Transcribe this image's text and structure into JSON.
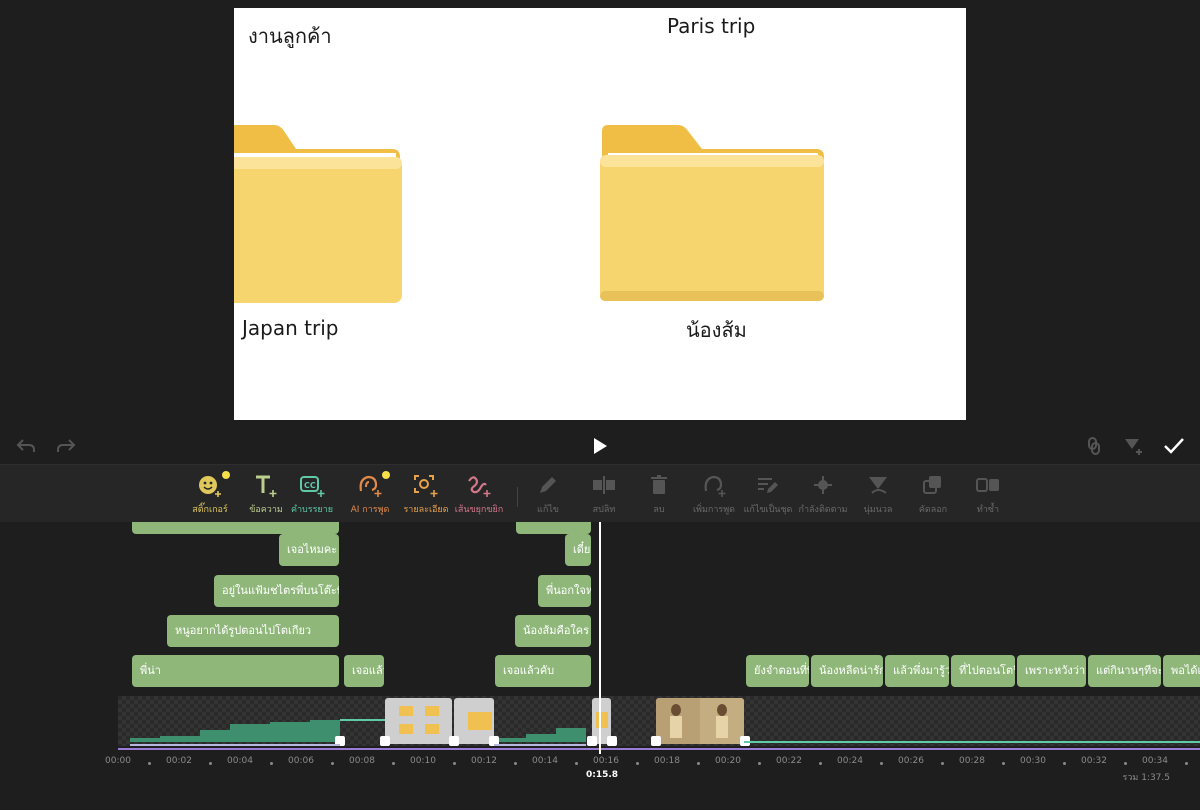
{
  "preview": {
    "folder_label_top_left": "งานลูกค้า",
    "folder_label_top_right": "Paris trip",
    "folder_label_bottom_left": "Japan trip",
    "folder_label_bottom_right": "น้องส้ม"
  },
  "toolbar": {
    "tools": [
      {
        "label": "สติ๊กเกอร์",
        "color": "#e0c85a"
      },
      {
        "label": "ข้อความ",
        "color": "#bcd08e"
      },
      {
        "label": "คำบรรยาย",
        "color": "#5fc9a8"
      },
      {
        "label": "AI การพูด",
        "color": "#e28a4a"
      },
      {
        "label": "รายละเอียด",
        "color": "#e8a14a"
      },
      {
        "label": "เส้นขยุกขยิก",
        "color": "#d3778a"
      },
      {
        "label": "แก้ไข",
        "color": "#6a6a6a"
      },
      {
        "label": "สปลิท",
        "color": "#6a6a6a"
      },
      {
        "label": "ลบ",
        "color": "#6a6a6a"
      },
      {
        "label": "เพิ่มการพูด",
        "color": "#6a6a6a"
      },
      {
        "label": "แก้ไขเป็นชุด",
        "color": "#6a6a6a"
      },
      {
        "label": "กำลังติดตาม",
        "color": "#6a6a6a"
      },
      {
        "label": "นุ่มนวล",
        "color": "#6a6a6a"
      },
      {
        "label": "คัดลอก",
        "color": "#6a6a6a"
      },
      {
        "label": "ทำซ้ำ",
        "color": "#6a6a6a"
      }
    ]
  },
  "captions": [
    {
      "text": "เจอไหมคะ"
    },
    {
      "text": "อยู่ในแฟ้มชไตรพี่บนโต๊ะพี่ ทา"
    },
    {
      "text": "หนูอยากได้รูปตอนไปโตเกียว"
    },
    {
      "text": "พี่น่า"
    },
    {
      "text": "เจอแล้ว"
    },
    {
      "text": "เดี๋ย"
    },
    {
      "text": "พี่นอกใจหร"
    },
    {
      "text": "น้องส้มคือใคร"
    },
    {
      "text": "เจอแล้วคับ"
    },
    {
      "text": "ยังจำตอนที่พี่"
    },
    {
      "text": "น้องหลีดน่ารักม"
    },
    {
      "text": "แล้วพึ่งมารู้ว่าเ"
    },
    {
      "text": "ที่ไปตอนโตฟิ"
    },
    {
      "text": "เพราะหวังว่าจะ"
    },
    {
      "text": "แต่กินานๆทีจะเจ"
    },
    {
      "text": "พอได้เจ"
    }
  ],
  "ruler": {
    "ticks": [
      "00:00",
      "00:02",
      "00:04",
      "00:06",
      "00:08",
      "00:10",
      "00:12",
      "00:14",
      "00:16",
      "00:18",
      "00:20",
      "00:22",
      "00:24",
      "00:26",
      "00:28",
      "00:30",
      "00:32",
      "00:34"
    ],
    "current_time": "0:15.8",
    "total": "รวม 1:37.5"
  }
}
